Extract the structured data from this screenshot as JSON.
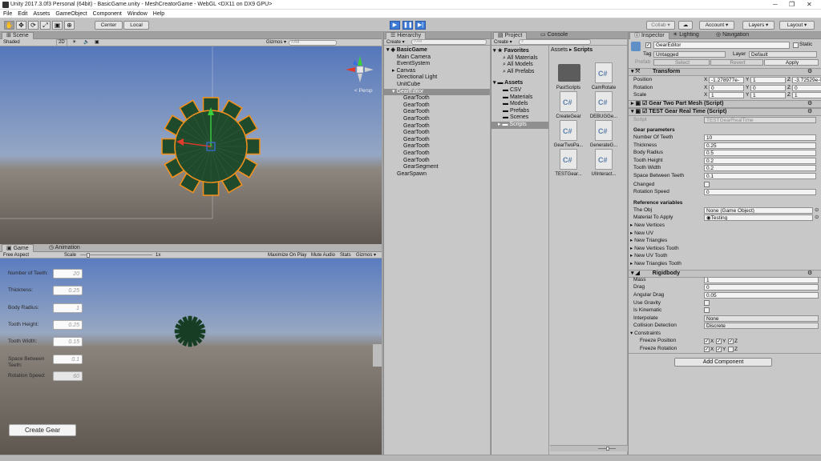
{
  "window": {
    "title": "Unity 2017.3.0f3 Personal (64bit) - BasicGame.unity - MeshCreatorGame - WebGL <DX11 on DX9 GPU>"
  },
  "menu": [
    "File",
    "Edit",
    "Assets",
    "GameObject",
    "Component",
    "Window",
    "Help"
  ],
  "toolbar": {
    "pivot_center": "Center",
    "pivot_local": "Local",
    "collab": "Collab ▾",
    "account": "Account",
    "layers": "Layers",
    "layout": "Layout"
  },
  "scene": {
    "tab_scene": "Scene",
    "shading": "Shaded",
    "mode_2d": "2D",
    "gizmos": "Gizmos ▾",
    "search": "All",
    "persp": "< Persp"
  },
  "game": {
    "tab_game": "Game",
    "tab_animation": "Animation",
    "aspect": "Free Aspect",
    "scale_label": "Scale",
    "scale_value": "1x",
    "maximize": "Maximize On Play",
    "mute": "Mute Audio",
    "stats": "Stats",
    "gizmos": "Gizmos ▾",
    "form": [
      {
        "label": "Number of Teeth:",
        "value": "20"
      },
      {
        "label": "Thickness:",
        "value": "0.25"
      },
      {
        "label": "Body Radius:",
        "value": "1"
      },
      {
        "label": "Tooth Height:",
        "value": "0.25"
      },
      {
        "label": "Tooth Width:",
        "value": "0.15"
      },
      {
        "label": "Space Between Teeth:",
        "value": "0.1"
      },
      {
        "label": "Rotation Speed:",
        "value": "60"
      }
    ],
    "create_button": "Create Gear"
  },
  "hierarchy": {
    "tab": "Hierarchy",
    "create": "Create ▾",
    "search": "All",
    "scene_name": "BasicGame",
    "items": [
      "Main Camera",
      "EventSystem",
      "Canvas",
      "Directional Light",
      "UnitCube"
    ],
    "selected": "GearEditor",
    "children": [
      "GearTooth",
      "GearTooth",
      "GearTooth",
      "GearTooth",
      "GearTooth",
      "GearTooth",
      "GearTooth",
      "GearTooth",
      "GearTooth",
      "GearTooth",
      "GearSegment"
    ],
    "last": "GearSpawn"
  },
  "project": {
    "tab_project": "Project",
    "tab_console": "Console",
    "create": "Create ▾",
    "favorites_label": "Favorites",
    "favorites": [
      "All Materials",
      "All Models",
      "All Prefabs"
    ],
    "assets_label": "Assets",
    "folders": [
      "CSV",
      "Materials",
      "Models",
      "Prefabs",
      "Scenes",
      "Scripts"
    ],
    "breadcrumb_root": "Assets",
    "breadcrumb_leaf": "Scripts",
    "files": [
      "PastScripts",
      "CamRotate",
      "CreateGear",
      "DEBUGGe...",
      "GearTwoPa...",
      "GenerateG...",
      "TESTGear...",
      "UIInteract..."
    ]
  },
  "inspector": {
    "tab_inspector": "Inspector",
    "tab_lighting": "Lighting",
    "tab_navigation": "Navigation",
    "object_name": "GearEditor",
    "static_label": "Static",
    "tag_label": "Tag",
    "tag_value": "Untagged",
    "layer_label": "Layer",
    "layer_value": "Default",
    "prefab_label": "Prefab",
    "prefab_select": "Select",
    "prefab_revert": "Revert",
    "prefab_apply": "Apply",
    "transform_title": "Transform",
    "position_label": "Position",
    "rotation_label": "Rotation",
    "scale_label": "Scale",
    "pos": [
      "-1.278977e-",
      "1",
      "-3.72529e-0"
    ],
    "rot": [
      "0",
      "0",
      "0"
    ],
    "scl": [
      "1",
      "1",
      "1"
    ],
    "comp1": "Gear Two Part Mesh (Script)",
    "comp2": "TEST Gear Real Time (Script)",
    "script_label": "Script",
    "script_value": "TESTGearRealTime",
    "gear_params_header": "Gear parameters",
    "params": [
      {
        "label": "Number Of Teeth",
        "value": "10"
      },
      {
        "label": "Thickness",
        "value": "0.25"
      },
      {
        "label": "Body Radius",
        "value": "0.5"
      },
      {
        "label": "Tooth Height",
        "value": "0.2"
      },
      {
        "label": "Tooth Width",
        "value": "0.2"
      },
      {
        "label": "Space Between Teeth",
        "value": "0.1"
      }
    ],
    "changed_label": "Changed",
    "rotation_speed_label": "Rotation Speed",
    "rotation_speed_value": "0",
    "ref_header": "Reference variables",
    "the_obj_label": "The Obj",
    "the_obj_value": "None (Game Object)",
    "material_label": "Material To Apply",
    "material_value": "Testing",
    "foldouts": [
      "New Vertices",
      "New UV",
      "New Triangles",
      "New Vertices Tooth",
      "New UV Tooth",
      "New Triangles Tooth"
    ],
    "rigidbody_title": "Rigidbody",
    "rb": [
      {
        "label": "Mass",
        "value": "1"
      },
      {
        "label": "Drag",
        "value": "0"
      },
      {
        "label": "Angular Drag",
        "value": "0.05"
      }
    ],
    "use_gravity": "Use Gravity",
    "is_kinematic": "Is Kinematic",
    "interpolate_label": "Interpolate",
    "interpolate_value": "None",
    "collision_label": "Collision Detection",
    "collision_value": "Discrete",
    "constraints": "Constraints",
    "freeze_pos": "Freeze Position",
    "freeze_rot": "Freeze Rotation",
    "axes": [
      "X",
      "Y",
      "Z"
    ],
    "add_component": "Add Component"
  },
  "colors": {
    "gear_fill": "#1f4a2c",
    "gear_outline": "#f0901e",
    "sky_top": "#5b7fc2",
    "ground": "#6e6760",
    "play_blue": "#3d7cd6"
  }
}
